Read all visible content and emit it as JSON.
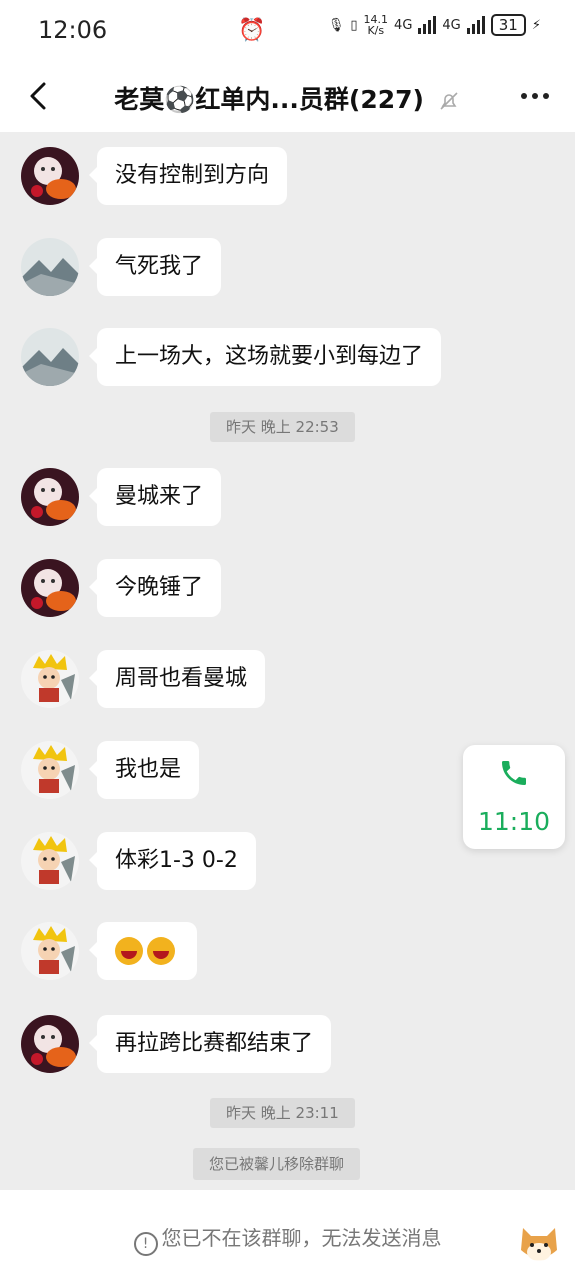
{
  "status_bar": {
    "time": "12:06",
    "speed_top": "14.1",
    "speed_unit": "K/s",
    "net1": "4G",
    "net2": "4G",
    "battery": "31"
  },
  "header": {
    "back_icon": "chevron-left-icon",
    "title": "老莫⚽红单内...员群(227)",
    "mute_icon": "bell-off-icon",
    "more_icon": "more-dots-icon"
  },
  "messages": [
    {
      "avatar": "avatar-cat-koi",
      "text": "没有控制到方向"
    },
    {
      "avatar": "avatar-mountain",
      "text": "气死我了"
    },
    {
      "avatar": "avatar-mountain",
      "text": "上一场大，这场就要小到每边了"
    },
    {
      "avatar": "avatar-cat-koi",
      "text": "曼城来了"
    },
    {
      "avatar": "avatar-cat-koi",
      "text": "今晚锤了"
    },
    {
      "avatar": "avatar-cartoon-boy",
      "text": "周哥也看曼城"
    },
    {
      "avatar": "avatar-cartoon-boy",
      "text": "我也是"
    },
    {
      "avatar": "avatar-cartoon-boy",
      "text": "体彩1-3 0-2"
    },
    {
      "avatar": "avatar-cartoon-boy",
      "text": "laughing-emoji x2"
    },
    {
      "avatar": "avatar-cat-koi",
      "text": "再拉跨比赛都结束了"
    }
  ],
  "timestamps": {
    "t1": "昨天 晚上 22:53",
    "t2": "昨天 晚上 23:11"
  },
  "system_note": "您已被馨儿移除群聊",
  "call_float": {
    "icon": "phone-icon",
    "duration": "11:10",
    "color": "#1aad5c"
  },
  "footer": {
    "icon": "info-icon",
    "text": "您已不在该群聊，无法发送消息"
  }
}
